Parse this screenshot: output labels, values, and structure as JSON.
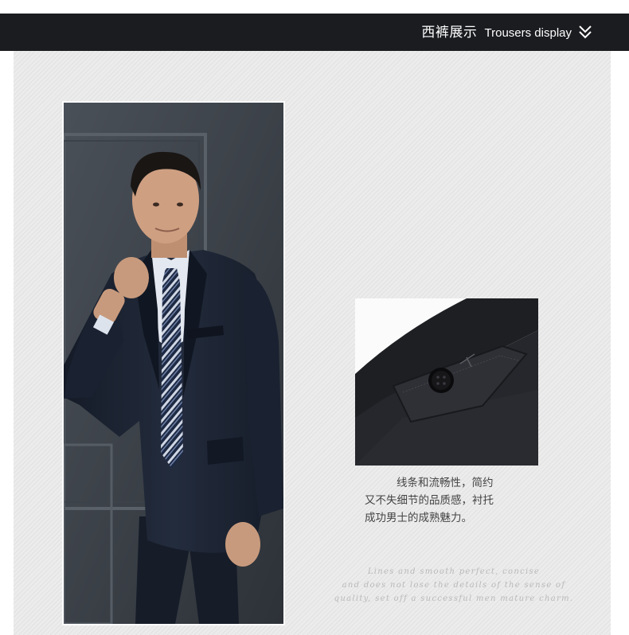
{
  "header": {
    "title_cn": "西裤展示",
    "title_en": "Trousers display",
    "icon": "double-chevron-down-icon"
  },
  "main_photo": {
    "description": "man in navy suit with striped tie"
  },
  "detail_photo": {
    "description": "close-up of trouser waistband with black button"
  },
  "caption": {
    "line1": "线条和流畅性，简约",
    "line2": "又不失细节的品质感，衬托",
    "line3": "成功男士的成熟魅力。"
  },
  "script_text": {
    "line1": "Lines and smooth perfect, concise",
    "line2": "and does not lose the details of the sense of",
    "line3": "quality, set off a successful men mature charm."
  },
  "colors": {
    "header_bg": "#1b1c20",
    "suit": "#1c2433",
    "background_panel": "#ececec"
  }
}
